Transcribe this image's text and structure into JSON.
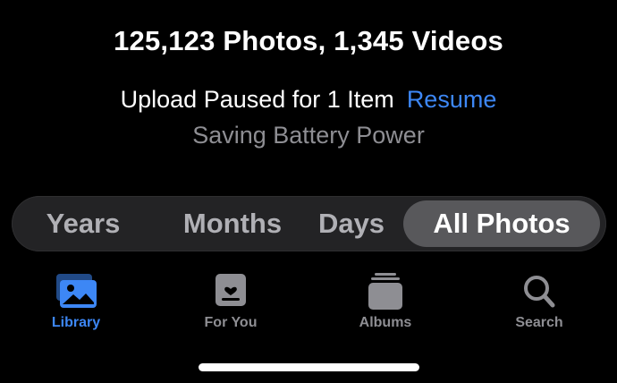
{
  "library_summary": "125,123 Photos, 1,345 Videos",
  "upload": {
    "status_text": "Upload Paused for 1 Item",
    "resume_label": "Resume",
    "reason_text": "Saving Battery Power"
  },
  "view_selector": {
    "options": [
      "Years",
      "Months",
      "Days",
      "All Photos"
    ],
    "selected": "All Photos"
  },
  "tab_bar": {
    "tabs": [
      {
        "label": "Library",
        "icon": "library-icon",
        "selected": true
      },
      {
        "label": "For You",
        "icon": "for-you-icon",
        "selected": false
      },
      {
        "label": "Albums",
        "icon": "albums-icon",
        "selected": false
      },
      {
        "label": "Search",
        "icon": "search-icon",
        "selected": false
      }
    ]
  },
  "colors": {
    "background": "#000000",
    "accent": "#3d87f5",
    "secondary_text": "#8e8e93",
    "segment_track": "#232325",
    "segment_selected": "#58585b"
  }
}
